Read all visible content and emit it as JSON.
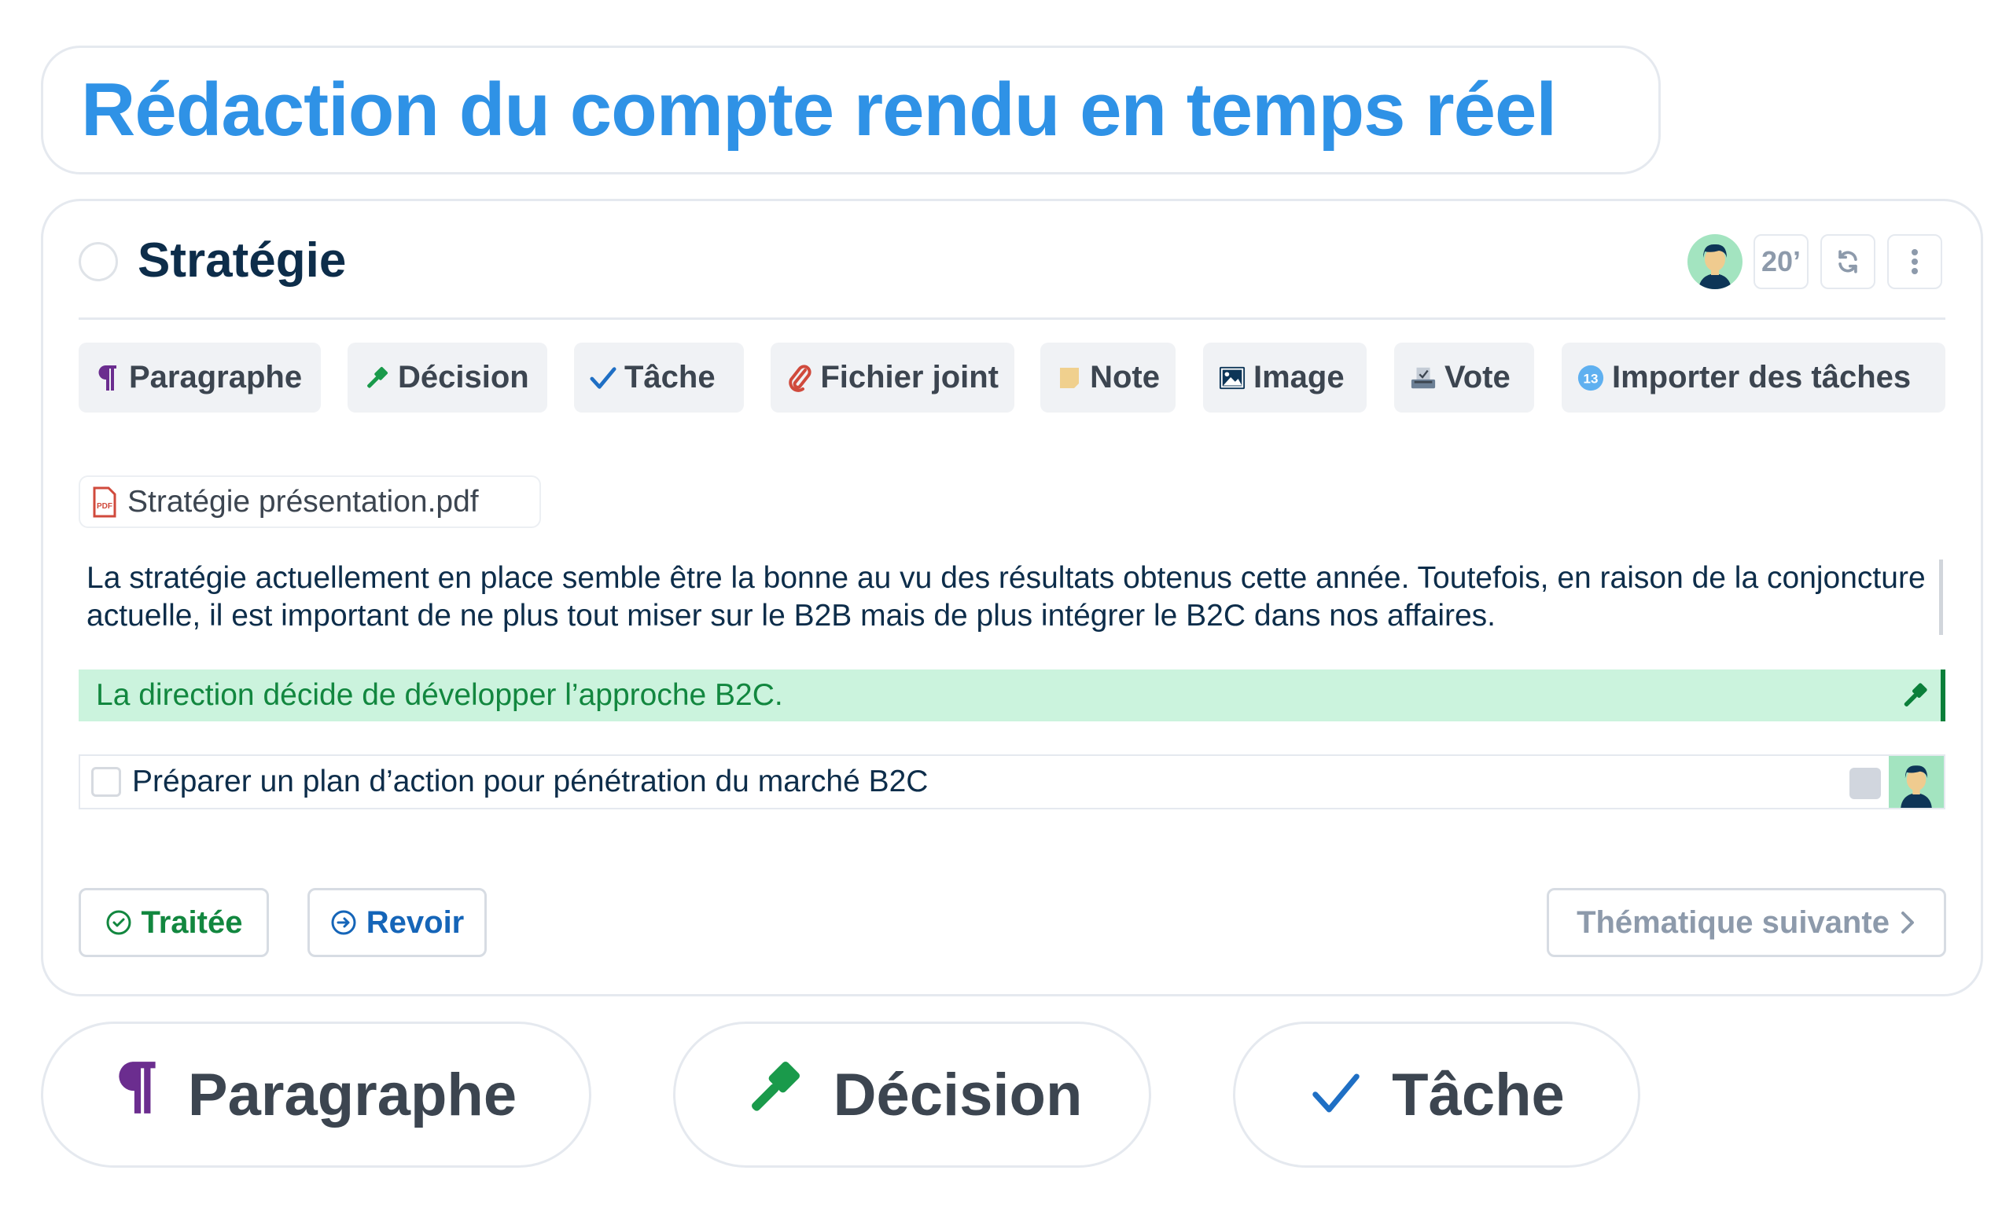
{
  "page_title": "Rédaction du compte rendu en temps réel",
  "topic": {
    "title": "Stratégie",
    "duration": "20’",
    "header_icons": [
      "user-avatar",
      "refresh-icon",
      "more-vertical-icon"
    ]
  },
  "toolbar": {
    "items": [
      {
        "label": "Paragraphe",
        "icon": "pilcrow-icon",
        "color": "#6b2d8f"
      },
      {
        "label": "Décision",
        "icon": "gavel-icon",
        "color": "#1a9a4b"
      },
      {
        "label": "Tâche",
        "icon": "check-icon",
        "color": "#1f6fc4"
      },
      {
        "label": "Fichier joint",
        "icon": "paperclip-icon",
        "color": "#d04a3c"
      },
      {
        "label": "Note",
        "icon": "note-icon",
        "color": "#f0d08e"
      },
      {
        "label": "Image",
        "icon": "image-icon",
        "color": "#0d3557"
      },
      {
        "label": "Vote",
        "icon": "ballot-box-icon",
        "color": "#6b7f95"
      },
      {
        "label": "Importer des tâches",
        "icon": "import-badge-icon",
        "badge": "13",
        "color": "#5fb0f0"
      }
    ]
  },
  "attachment": {
    "filename": "Stratégie présentation.pdf",
    "icon_label": "PDF"
  },
  "paragraph": "La stratégie actuellement en place semble être la bonne au vu des résultats obtenus cette année. Toutefois, en raison de la conjoncture actuelle, il est important de ne plus tout miser sur le B2B mais de plus intégrer le B2C dans nos affaires.",
  "decision": "La direction décide de développer l’approche B2C.",
  "task": {
    "label": "Préparer un plan d’action pour pénétration du marché B2C",
    "checked": false
  },
  "actions": {
    "treated": "Traitée",
    "review": "Revoir",
    "next": "Thématique suivante"
  },
  "bottom_pills": [
    {
      "label": "Paragraphe",
      "icon": "pilcrow-icon"
    },
    {
      "label": "Décision",
      "icon": "gavel-icon"
    },
    {
      "label": "Tâche",
      "icon": "check-icon"
    }
  ],
  "colors": {
    "title_blue": "#2f92e6",
    "dark_navy": "#0d2d4a",
    "decision_bg": "#cbf3dd",
    "decision_text": "#12873f",
    "review_blue": "#1565b8",
    "muted_gray": "#8d9aab"
  }
}
